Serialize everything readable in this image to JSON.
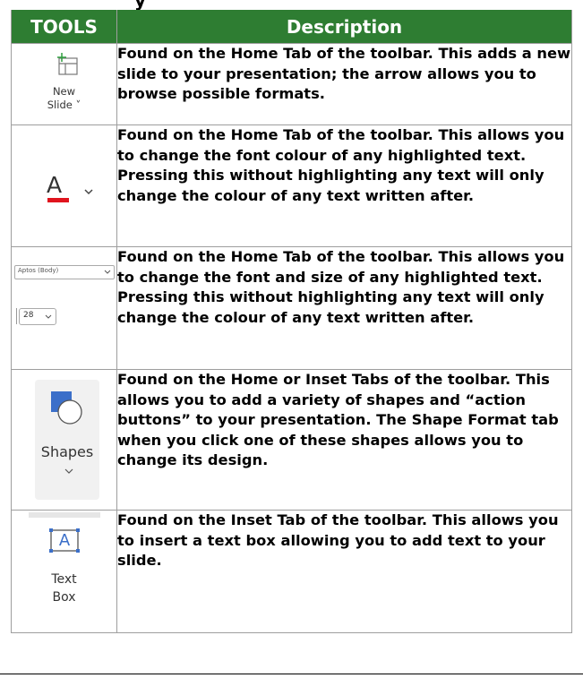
{
  "header": {
    "tools": "TOOLS",
    "description": "Description"
  },
  "rows": [
    {
      "icon": "new-slide-icon",
      "label_line1": "New",
      "label_line2": "Slide ˅",
      "description": "Found on the Home Tab of the toolbar. This adds a new slide to your presentation; the arrow allows you to browse possible formats."
    },
    {
      "icon": "font-colour-icon",
      "glyph": "A",
      "chevron": "⌄",
      "description": "Found on the Home Tab of the toolbar. This allows you to change the font colour of any highlighted text. Pressing this without highlighting any text will only change the colour of any text written after."
    },
    {
      "icon": "font-and-size-icon",
      "font_value": "Aptos (Body)",
      "size_value": "28",
      "description": "Found on the Home Tab of the toolbar. This allows you to change the font and size of any highlighted text. Pressing this without highlighting any text will only change the colour of any text written after."
    },
    {
      "icon": "shapes-icon",
      "label": "Shapes",
      "chevron": "⌄",
      "description": "Found on the Home or Inset Tabs of the toolbar. This allows you to add a variety of shapes and “action buttons” to your presentation. The Shape Format tab when you click one of these shapes allows you to change its design."
    },
    {
      "icon": "text-box-icon",
      "glyph": "A",
      "label_line1": "Text",
      "label_line2": "Box",
      "description": "Found on the Inset Tab of the toolbar. This allows you to insert a text box allowing you to add text to your slide."
    }
  ],
  "colors": {
    "header_bg": "#2e7d32",
    "font_colour_bar": "#e0141e",
    "icon_blue": "#3b6fc9"
  }
}
